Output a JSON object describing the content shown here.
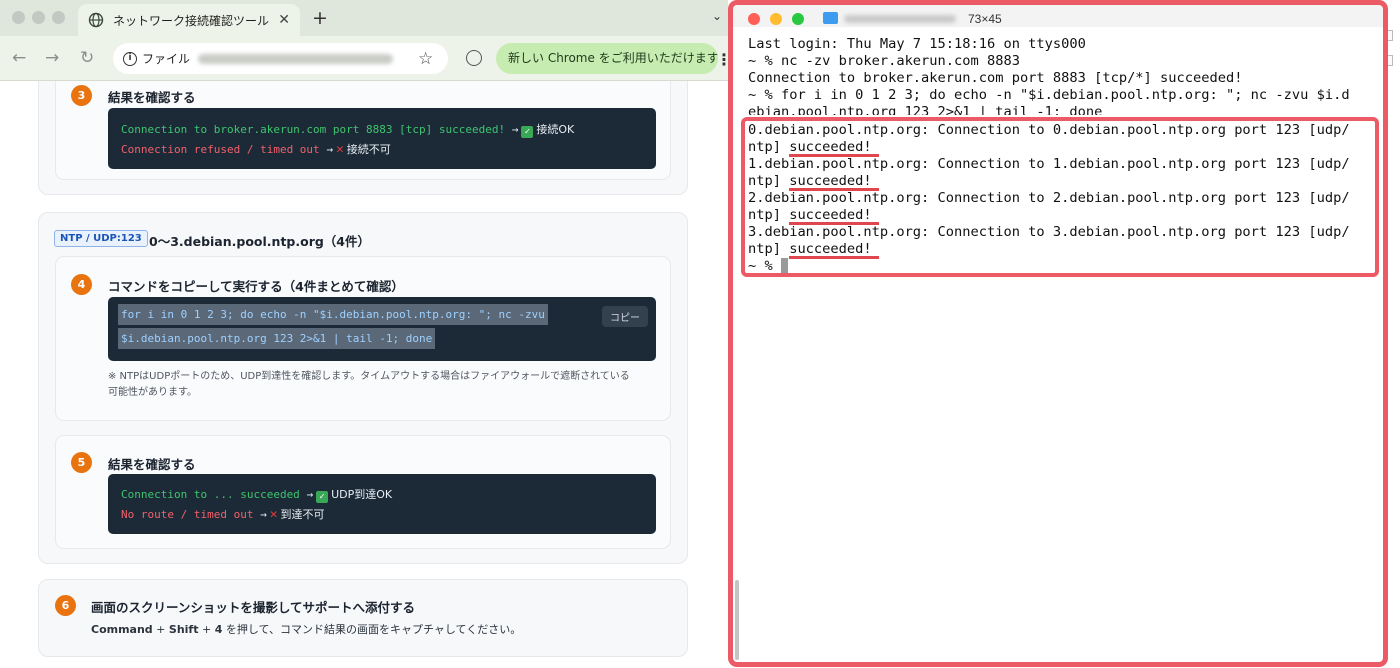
{
  "browser": {
    "tab_title": "ネットワーク接続確認ツール",
    "new_tab": "+",
    "tab_close": "✕",
    "omnibox_scheme": "ファイル",
    "update_pill": "新しい Chrome をご利用いただけます",
    "nav_back": "←",
    "nav_forward": "→",
    "nav_reload": "↻"
  },
  "page": {
    "step3": {
      "number": "3",
      "title": "結果を確認する",
      "ok_code": "Connection to broker.akerun.com port 8883 [tcp] succeeded!",
      "ok_label": "接続OK",
      "ng_code": "Connection refused / timed out",
      "ng_label": "接続不可"
    },
    "ntp_section": {
      "badge": "NTP / UDP:123",
      "title": "0〜3.debian.pool.ntp.org（4件）"
    },
    "step4": {
      "number": "4",
      "title": "コマンドをコピーして実行する（4件まとめて確認）",
      "code_line1": "for i in 0 1 2 3; do echo -n \"$i.debian.pool.ntp.org: \"; nc -zvu",
      "code_line2": "$i.debian.pool.ntp.org 123 2>&1 | tail -1; done",
      "copy_label": "コピー",
      "note_line1": "※ NTPはUDPポートのため、UDP到達性を確認します。タイムアウトする場合はファイアウォールで遮断されている",
      "note_line2": "可能性があります。"
    },
    "step5": {
      "number": "5",
      "title": "結果を確認する",
      "ok_code": "Connection to ... succeeded",
      "ok_label": "UDP到達OK",
      "ng_code": "No route / timed out",
      "ng_label": "到達不可"
    },
    "step6": {
      "number": "6",
      "title": "画面のスクリーンショットを撮影してサポートへ添付する",
      "key1": "Command",
      "plus1": " + ",
      "key2": "Shift",
      "plus2": " + ",
      "key3": "4",
      "rest": " を押して、コマンド結果の画面をキャプチャしてください。"
    },
    "arrow": "→"
  },
  "terminal": {
    "title_size": "73×45",
    "lines": [
      "Last login: Thu May  7 15:18:16 on ttys000",
      "~ % nc -zv broker.akerun.com 8883",
      "Connection to broker.akerun.com port 8883 [tcp/*] succeeded!",
      "~ % for i in 0 1 2 3; do echo -n \"$i.debian.pool.ntp.org: \"; nc -zvu $i.d",
      "ebian.pool.ntp.org 123 2>&1 | tail -1; done",
      "0.debian.pool.ntp.org: Connection to 0.debian.pool.ntp.org port 123 [udp/",
      "ntp] succeeded!",
      "1.debian.pool.ntp.org: Connection to 1.debian.pool.ntp.org port 123 [udp/",
      "ntp] succeeded!",
      "2.debian.pool.ntp.org: Connection to 2.debian.pool.ntp.org port 123 [udp/",
      "ntp] succeeded!",
      "3.debian.pool.ntp.org: Connection to 3.debian.pool.ntp.org port 123 [udp/",
      "ntp] succeeded!",
      "~ % "
    ]
  },
  "colors": {
    "highlight": "#ec5b65",
    "step_accent": "#e8730f",
    "code_bg": "#1c2a38",
    "code_ok": "#3ec46d",
    "code_ng": "#f0606a",
    "update_pill": "#c7ecb2"
  }
}
